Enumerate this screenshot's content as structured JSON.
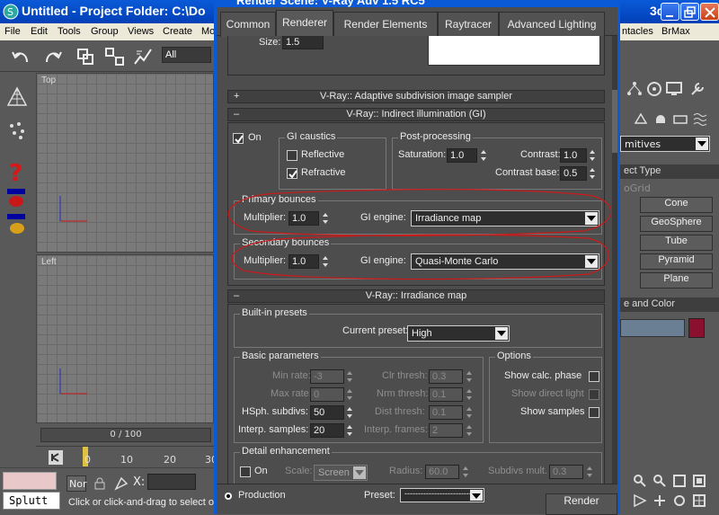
{
  "window": {
    "title": "Untitled - Project Folder: C:\\Do",
    "title_right": "3d..."
  },
  "dialog": {
    "title": "Render Scene: V-Ray Adv 1.5 RC5",
    "tabs": [
      "Common",
      "Renderer",
      "Render Elements",
      "Raytracer",
      "Advanced Lighting"
    ],
    "active_tab": "Renderer",
    "size_label": "Size:",
    "size_value": "1.5"
  },
  "menubar": [
    "File",
    "Edit",
    "Tools",
    "Group",
    "Views",
    "Create",
    "Mo",
    "ntacles",
    "BrMax"
  ],
  "toolbar": {
    "selection_filter": "All"
  },
  "viewports": {
    "top_label": "Top",
    "left_label": "Left"
  },
  "timeline": {
    "frame_display": "0 / 100",
    "ruler": [
      "0",
      "10",
      "20",
      "30"
    ]
  },
  "statusbar": {
    "splutt": "Splutt",
    "none_label": "Nor",
    "x_label": "X:",
    "hint": "Click or click-and-drag to select o"
  },
  "adaptive_subdivision": {
    "header": "V-Ray:: Adaptive subdivision image sampler",
    "toggle": "+"
  },
  "indirect_illumination": {
    "header": "V-Ray:: Indirect illumination (GI)",
    "toggle": "–",
    "on_label": "On",
    "on_checked": true,
    "gi_caustics": {
      "title": "GI caustics",
      "reflective_label": "Reflective",
      "reflective_checked": false,
      "refractive_label": "Refractive",
      "refractive_checked": true
    },
    "post_processing": {
      "title": "Post-processing",
      "saturation_label": "Saturation:",
      "saturation_value": "1.0",
      "contrast_label": "Contrast:",
      "contrast_value": "1.0",
      "contrast_base_label": "Contrast base:",
      "contrast_base_value": "0.5"
    },
    "primary": {
      "title": "Primary bounces",
      "multiplier_label": "Multiplier:",
      "multiplier_value": "1.0",
      "engine_label": "GI engine:",
      "engine_value": "Irradiance map"
    },
    "secondary": {
      "title": "Secondary bounces",
      "multiplier_label": "Multiplier:",
      "multiplier_value": "1.0",
      "engine_label": "GI engine:",
      "engine_value": "Quasi-Monte Carlo"
    }
  },
  "irradiance_map": {
    "header": "V-Ray:: Irradiance map",
    "toggle": "–",
    "builtin_presets": {
      "title": "Built-in presets",
      "current_preset_label": "Current preset:",
      "current_preset_value": "High"
    },
    "basic_parameters": {
      "title": "Basic parameters",
      "min_rate_label": "Min rate:",
      "min_rate_value": "-3",
      "max_rate_label": "Max rate:",
      "max_rate_value": "0",
      "hsph_label": "HSph. subdivs:",
      "hsph_value": "50",
      "interp_samples_label": "Interp. samples:",
      "interp_samples_value": "20",
      "clr_thresh_label": "Clr thresh:",
      "clr_thresh_value": "0.3",
      "nrm_thresh_label": "Nrm thresh:",
      "nrm_thresh_value": "0.1",
      "dist_thresh_label": "Dist thresh:",
      "dist_thresh_value": "0.1",
      "interp_frames_label": "Interp. frames:",
      "interp_frames_value": "2"
    },
    "options": {
      "title": "Options",
      "show_calc_phase": "Show calc. phase",
      "show_direct_light": "Show direct light",
      "show_samples": "Show samples"
    },
    "detail": {
      "title": "Detail enhancement",
      "on_label": "On",
      "scale_label": "Scale:",
      "scale_value": "Screen",
      "radius_label": "Radius:",
      "radius_value": "60.0",
      "subdivs_mult_label": "Subdivs mult.",
      "subdivs_mult_value": "0.3"
    }
  },
  "bottom": {
    "production_label": "Production",
    "preset_label": "Preset:",
    "preset_value": "-------------------------",
    "render_label": "Render"
  },
  "command_panel": {
    "category": "mitives",
    "object_type_title": "ect Type",
    "autogrid": "oGrid",
    "buttons": [
      "Cone",
      "GeoSphere",
      "Tube",
      "Pyramid",
      "Plane"
    ],
    "name_color_title": "e and Color",
    "color": "#8b1030"
  },
  "annotation_color": "#cc1a1a"
}
